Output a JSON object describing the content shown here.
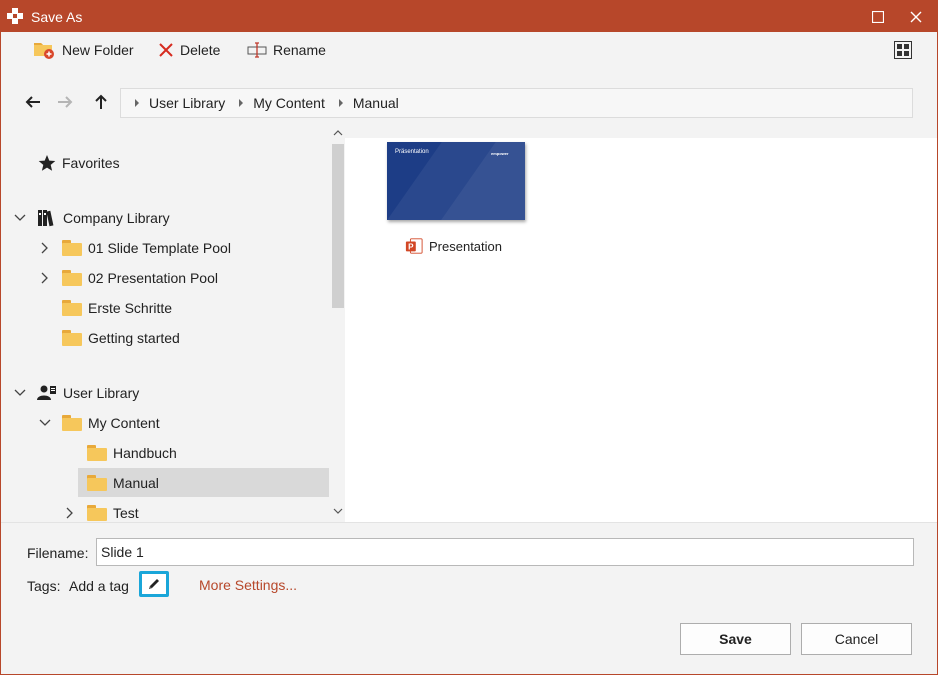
{
  "window": {
    "title": "Save As",
    "accent_color": "#b7472a"
  },
  "toolbar": {
    "new_folder_label": "New Folder",
    "delete_label": "Delete",
    "rename_label": "Rename",
    "view_icon": "grid-view-icon"
  },
  "nav": {
    "breadcrumb": [
      "User Library",
      "My Content",
      "Manual"
    ]
  },
  "tree": {
    "favorites": "Favorites",
    "company_library": "Company Library",
    "company_items": [
      "01 Slide Template Pool",
      "02 Presentation Pool",
      "Erste Schritte",
      "Getting started"
    ],
    "user_library": "User Library",
    "my_content": "My Content",
    "my_content_items": [
      "Handbuch",
      "Manual",
      "Test"
    ],
    "selected": "Manual"
  },
  "content": {
    "files": [
      {
        "name": "Presentation",
        "thumb_title": "Präsentation",
        "thumb_brand": "empower"
      }
    ]
  },
  "form": {
    "filename_label": "Filename:",
    "filename_value": "Slide 1",
    "tags_label": "Tags:",
    "tags_placeholder": "Add a tag",
    "more_settings": "More Settings...",
    "link_color": "#b7472a",
    "highlight_color": "#1aa6d9"
  },
  "buttons": {
    "save": "Save",
    "cancel": "Cancel"
  }
}
